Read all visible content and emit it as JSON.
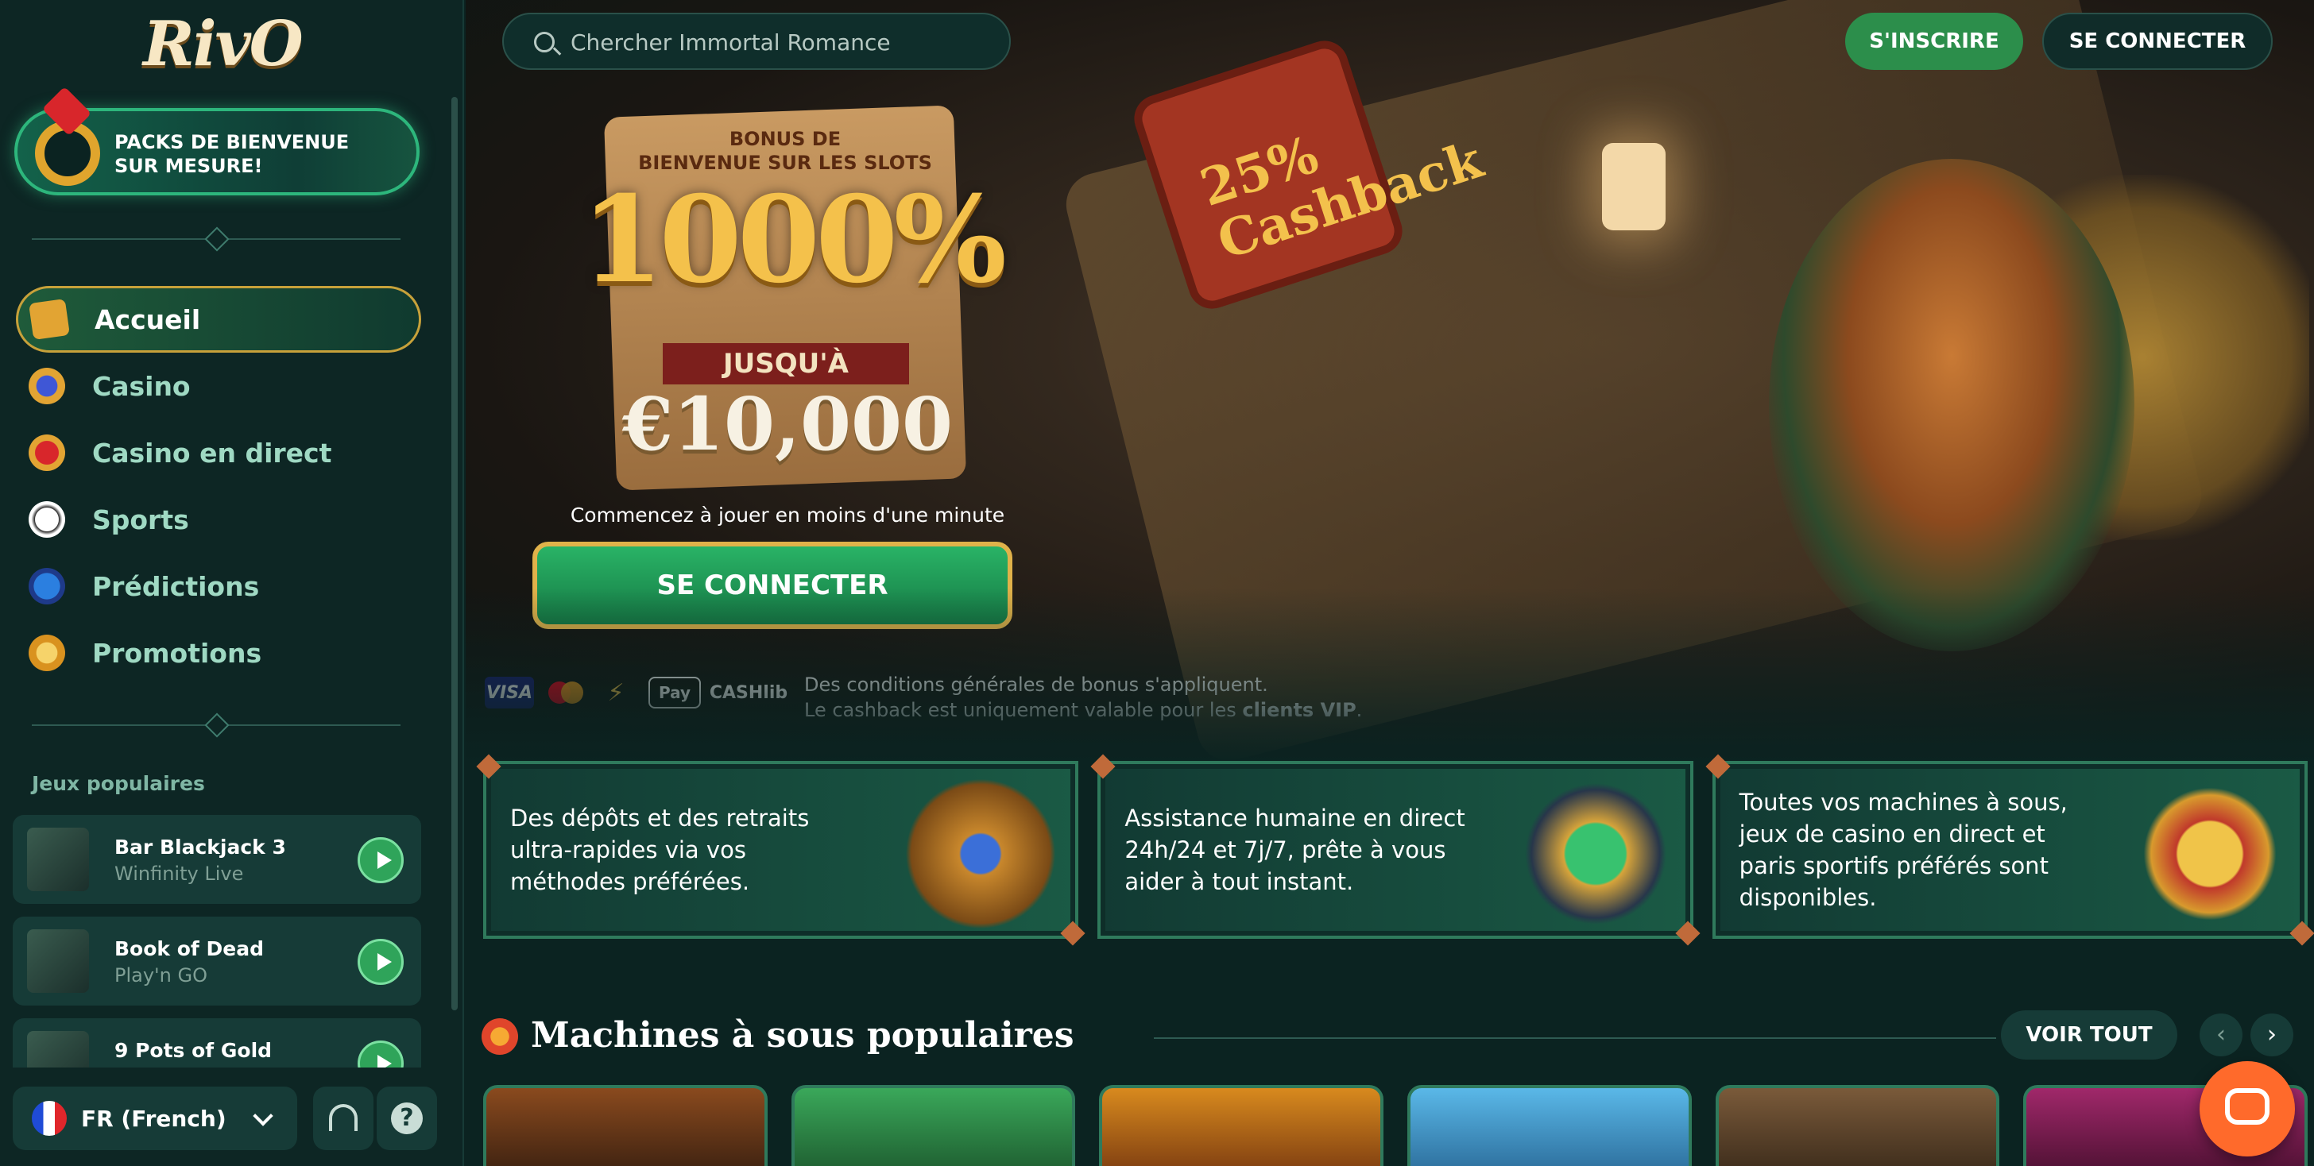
{
  "sidebar": {
    "logo": "RivO",
    "welcome_pack": "PACKS DE BIENVENUE\nSUR MESURE!",
    "nav": [
      {
        "label": "Accueil",
        "icon": "scroll-icon"
      },
      {
        "label": "Casino",
        "icon": "casino-chip-icon"
      },
      {
        "label": "Casino en direct",
        "icon": "live-casino-icon"
      },
      {
        "label": "Sports",
        "icon": "soccer-ball-icon"
      },
      {
        "label": "Prédictions",
        "icon": "predictions-orb-icon"
      },
      {
        "label": "Promotions",
        "icon": "crown-coin-icon"
      }
    ],
    "popular_title": "Jeux populaires",
    "games": [
      {
        "name": "Bar Blackjack 3",
        "provider": "Winfinity Live"
      },
      {
        "name": "Book of Dead",
        "provider": "Play'n GO"
      },
      {
        "name": "9 Pots of Gold",
        "provider": ""
      }
    ],
    "language": "FR (French)"
  },
  "header": {
    "search_placeholder": "Chercher Immortal Romance",
    "signup_label": "S'INSCRIRE",
    "login_label": "SE CONNECTER"
  },
  "hero": {
    "bonus_title": "BONUS DE\nBIENVENUE SUR LES SLOTS",
    "bonus_percent": "1000%",
    "bonus_upto": "JUSQU'À",
    "bonus_amount": "€10,000",
    "book_text": "25%\nCashback",
    "subtitle": "Commencez à jouer en moins d'une minute",
    "cta_label": "SE CONNECTER",
    "payments": [
      "VISA",
      "",
      "⚡",
      "Pay",
      "CASHlib"
    ],
    "terms_line1": "Des conditions générales de bonus s'appliquent.",
    "terms_line2_prefix": "Le cashback est uniquement valable pour les ",
    "terms_line2_bold": "clients VIP",
    "terms_line2_suffix": "."
  },
  "features": [
    {
      "text": "Des dépôts et des retraits ultra-rapides via vos méthodes préférées."
    },
    {
      "text": "Assistance humaine en direct 24h/24 et 7j/7, prête à vous aider à tout instant."
    },
    {
      "text": "Toutes vos machines à sous, jeux de casino en direct et paris sportifs préférés sont disponibles."
    }
  ],
  "slots_section": {
    "title": "Machines à sous populaires",
    "view_all": "VOIR TOUT",
    "prev": "‹",
    "next": "›"
  },
  "colors": {
    "background": "#0b2321",
    "accent_green": "#2c8e4b",
    "gold": "#e0b24a",
    "chat": "#ff6a2b"
  }
}
